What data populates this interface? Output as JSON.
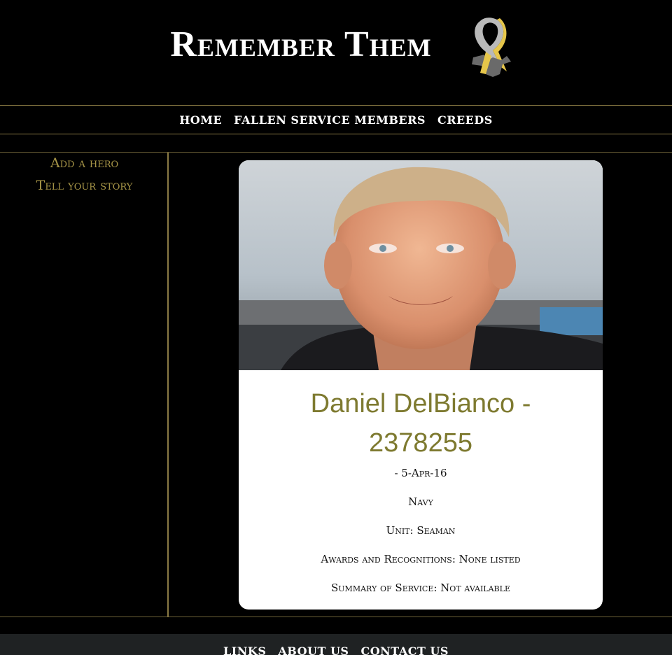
{
  "site": {
    "title": "Remember Them",
    "logo_icon": "ribbon-eagle-icon"
  },
  "nav": {
    "items": [
      {
        "label": "HOME"
      },
      {
        "label": "FALLEN SERVICE MEMBERS"
      },
      {
        "label": "CREEDS"
      }
    ]
  },
  "sidebar": {
    "items": [
      {
        "label": "Add a hero"
      },
      {
        "label": "Tell your story"
      }
    ]
  },
  "profile": {
    "name": "Daniel DelBianco - 2378255",
    "dates": "- 5-Apr-16",
    "branch": "Navy",
    "unit": "Unit: Seaman",
    "awards": "Awards and Recognitions: None listed",
    "summary": "Summary of Service: Not available"
  },
  "footer": {
    "items": [
      {
        "label": "LINKS"
      },
      {
        "label": "ABOUT US"
      },
      {
        "label": "CONTACT US"
      }
    ]
  },
  "colors": {
    "accent_gold": "#a89648",
    "name_olive": "#7e7a30",
    "rule_gold": "#8a7a44"
  }
}
